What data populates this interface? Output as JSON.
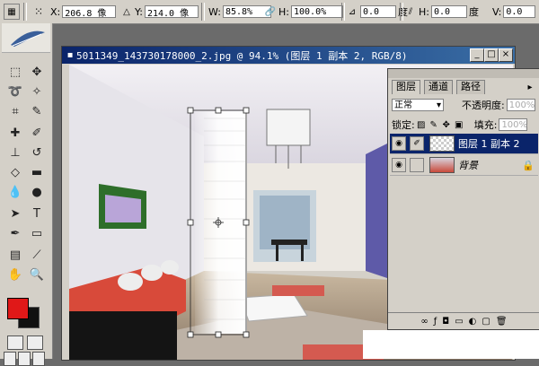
{
  "options_bar": {
    "x_label": "X:",
    "x_value": "206.8 像",
    "y_label": "Y:",
    "y_value": "214.0 像",
    "w_label": "W:",
    "w_value": "85.8%",
    "h_label": "H:",
    "h_value": "100.0%",
    "angle_value": "0.0",
    "angle_unit": "度",
    "hskew_label": "H:",
    "hskew_value": "0.0",
    "hskew_unit": "度",
    "vskew_label": "V:",
    "vskew_value": "0.0"
  },
  "document": {
    "title": "5011349_143730178000_2.jpg @ 94.1% (图层 1 副本 2, RGB/8)",
    "min_icon": "_",
    "max_icon": "□",
    "close_icon": "×"
  },
  "layers_panel": {
    "tabs": [
      "图层",
      "通道",
      "路径"
    ],
    "blend_mode": "正常",
    "opacity_label": "不透明度:",
    "opacity_value": "100%",
    "lock_label": "锁定:",
    "fill_label": "填充:",
    "fill_value": "100%",
    "layers": [
      {
        "name": "图层 1 副本 2",
        "selected": true
      },
      {
        "name": "背景",
        "selected": false
      }
    ]
  },
  "colors": {
    "foreground": "#e01818",
    "background": "#111111",
    "title_bar": "#0a246a",
    "panel_bg": "#d4d0c8"
  }
}
